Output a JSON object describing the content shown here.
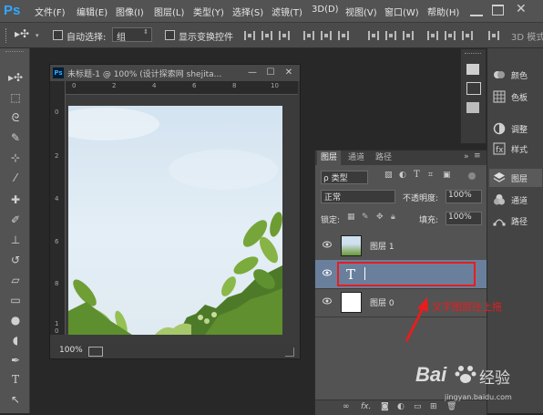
{
  "app": {
    "logo": "Ps"
  },
  "menu": {
    "items": [
      "文件(F)",
      "编辑(E)",
      "图像(I)",
      "图层(L)",
      "类型(Y)",
      "选择(S)",
      "滤镜(T)",
      "3D(D)",
      "视图(V)",
      "窗口(W)",
      "帮助(H)"
    ]
  },
  "options_bar": {
    "auto_select_label": "自动选择:",
    "auto_select_value": "组",
    "show_transform_label": "显示变换控件",
    "mode_3d_label": "3D 模式"
  },
  "document": {
    "title": "未标题-1 @ 100% (设计探索网 shejita...",
    "ruler_h": [
      "0",
      "2",
      "4",
      "6",
      "8",
      "10"
    ],
    "ruler_v": [
      "0",
      "2",
      "4",
      "6",
      "8",
      "1",
      "0"
    ],
    "zoom": "100%"
  },
  "layers_panel": {
    "tabs": [
      "图层",
      "通道",
      "路径"
    ],
    "filter_label": "ρ 类型",
    "blend_mode": "正常",
    "opacity_label": "不透明度:",
    "opacity_value": "100%",
    "lock_label": "锁定:",
    "fill_label": "填充:",
    "fill_value": "100%",
    "layers": [
      {
        "name": "图层 1"
      },
      {
        "name": "",
        "type_glyph": "T"
      },
      {
        "name": "图层 0"
      }
    ],
    "footer_fx": "fx."
  },
  "right_panel": {
    "items": [
      "颜色",
      "色板",
      "调整",
      "样式",
      "图层",
      "通道",
      "路径"
    ]
  },
  "annotation": {
    "text": "文字图层往上拖",
    "color": "#e81d1d"
  },
  "watermark": {
    "brand": "Bai",
    "brand2": "经验",
    "url": "jingyan.baidu.com"
  },
  "colors": {
    "accent_blue": "#31a8ff",
    "selected_layer": "#6a7f9c",
    "highlight_red": "#e81d1d"
  }
}
